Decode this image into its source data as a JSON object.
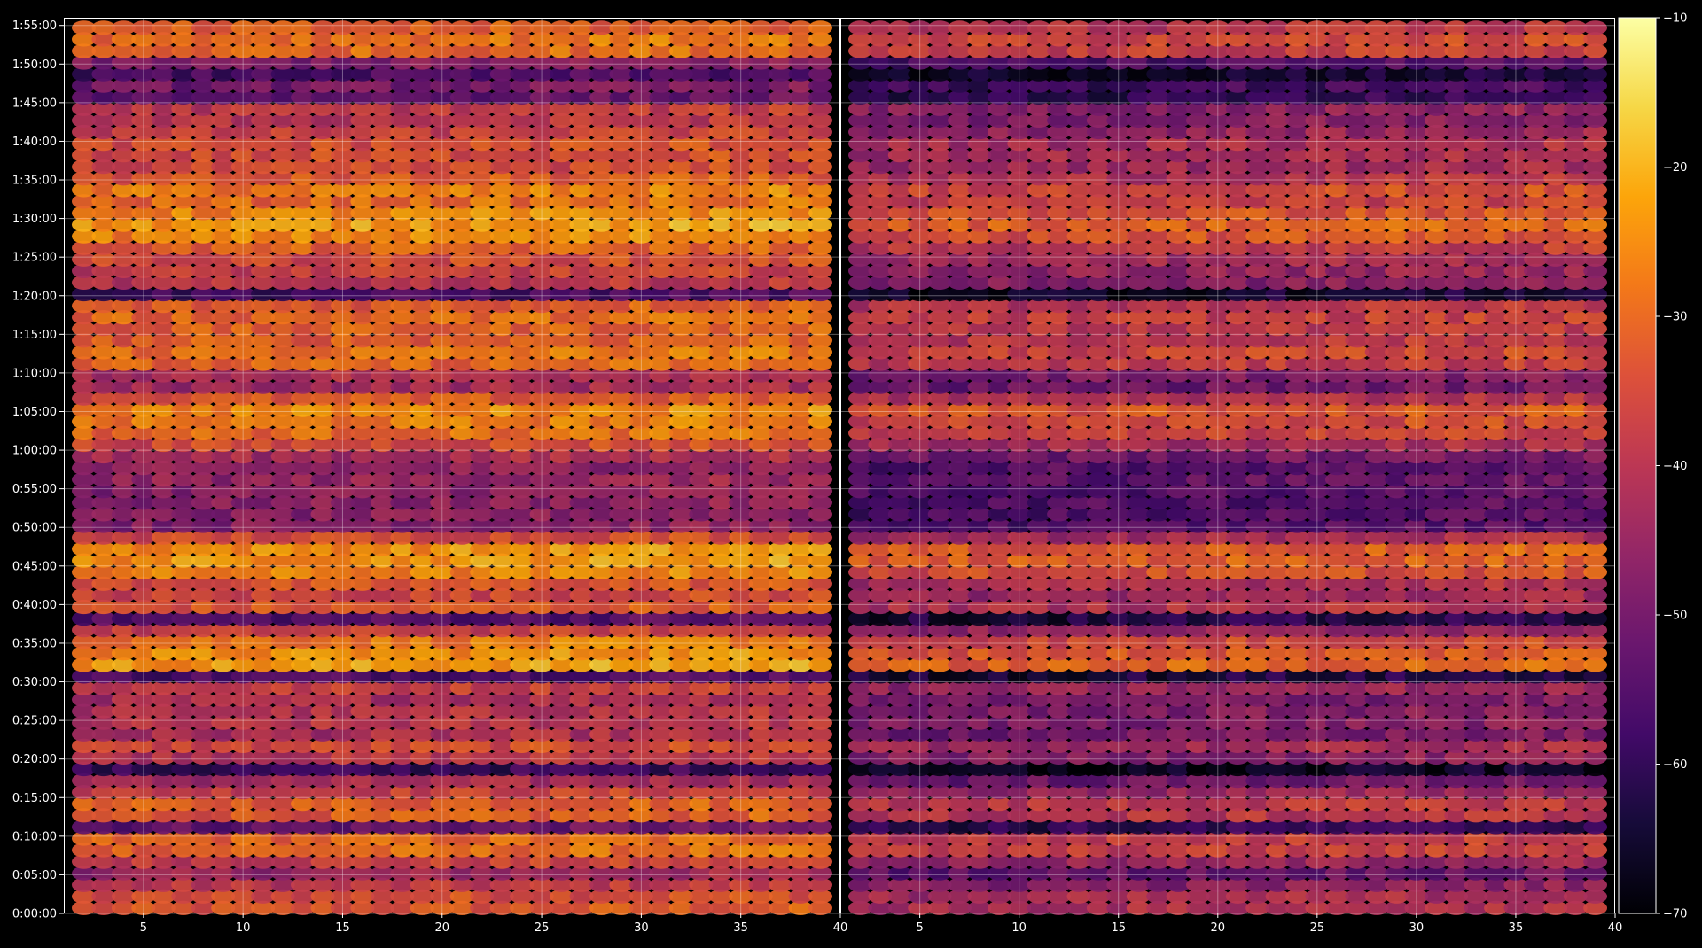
{
  "chart_data": {
    "type": "heatmap",
    "title": "",
    "colormap": "inferno",
    "background": "#000000",
    "y_ticks": [
      "0:00:00",
      "0:05:00",
      "0:10:00",
      "0:15:00",
      "0:20:00",
      "0:25:00",
      "0:30:00",
      "0:35:00",
      "0:40:00",
      "0:45:00",
      "0:50:00",
      "0:55:00",
      "1:00:00",
      "1:05:00",
      "1:10:00",
      "1:15:00",
      "1:20:00",
      "1:25:00",
      "1:30:00",
      "1:35:00",
      "1:40:00",
      "1:45:00",
      "1:50:00",
      "1:55:00"
    ],
    "y_range_minutes": [
      0,
      116
    ],
    "grid": true,
    "panels": [
      {
        "name": "left",
        "xlabel": "",
        "xlim": [
          1,
          40
        ],
        "x_ticks": [
          5,
          10,
          15,
          20,
          25,
          30,
          35,
          40
        ],
        "x_columns": [
          2,
          39
        ],
        "level_offset": 0
      },
      {
        "name": "right",
        "xlabel": "",
        "xlim": [
          1,
          40
        ],
        "x_ticks": [
          5,
          10,
          15,
          20,
          25,
          30,
          35,
          40
        ],
        "x_columns": [
          2,
          39
        ],
        "level_offset": -8
      }
    ],
    "colorbar": {
      "label": "",
      "range": [
        -70,
        -10
      ],
      "ticks": [
        -10,
        -20,
        -30,
        -40,
        -50,
        -60,
        -70
      ],
      "placement": "right"
    },
    "row_profile": {
      "description_units": "minutes, dB",
      "points": [
        [
          0.0,
          -34
        ],
        [
          1.5,
          -32
        ],
        [
          3.5,
          -38
        ],
        [
          5.0,
          -45
        ],
        [
          6.5,
          -38
        ],
        [
          8.0,
          -30
        ],
        [
          9.5,
          -26
        ],
        [
          11.0,
          -55
        ],
        [
          12.5,
          -32
        ],
        [
          14.0,
          -30
        ],
        [
          15.5,
          -36
        ],
        [
          17.0,
          -40
        ],
        [
          18.5,
          -62
        ],
        [
          20.0,
          -40
        ],
        [
          21.5,
          -34
        ],
        [
          23.0,
          -42
        ],
        [
          24.5,
          -40
        ],
        [
          26.0,
          -40
        ],
        [
          27.5,
          -42
        ],
        [
          29.5,
          -36
        ],
        [
          30.5,
          -60
        ],
        [
          32.0,
          -22
        ],
        [
          33.5,
          -24
        ],
        [
          35.0,
          -26
        ],
        [
          36.5,
          -34
        ],
        [
          38.0,
          -58
        ],
        [
          39.5,
          -32
        ],
        [
          40.5,
          -34
        ],
        [
          42.0,
          -38
        ],
        [
          43.5,
          -28
        ],
        [
          45.0,
          -24
        ],
        [
          46.5,
          -22
        ],
        [
          48.0,
          -26
        ],
        [
          49.5,
          -44
        ],
        [
          51.0,
          -50
        ],
        [
          52.5,
          -44
        ],
        [
          54.0,
          -50
        ],
        [
          55.5,
          -42
        ],
        [
          57.0,
          -48
        ],
        [
          58.5,
          -44
        ],
        [
          60.0,
          -40
        ],
        [
          61.5,
          -28
        ],
        [
          63.0,
          -30
        ],
        [
          64.5,
          -24
        ],
        [
          66.0,
          -26
        ],
        [
          67.5,
          -40
        ],
        [
          69.0,
          -46
        ],
        [
          70.5,
          -34
        ],
        [
          72.0,
          -26
        ],
        [
          73.5,
          -30
        ],
        [
          75.0,
          -32
        ],
        [
          76.5,
          -30
        ],
        [
          78.5,
          -28
        ],
        [
          80.5,
          -62
        ],
        [
          82.0,
          -34
        ],
        [
          83.5,
          -38
        ],
        [
          85.0,
          -34
        ],
        [
          86.5,
          -30
        ],
        [
          88.0,
          -24
        ],
        [
          89.5,
          -22
        ],
        [
          91.0,
          -26
        ],
        [
          92.5,
          -30
        ],
        [
          94.0,
          -26
        ],
        [
          95.5,
          -34
        ],
        [
          97.0,
          -36
        ],
        [
          98.5,
          -34
        ],
        [
          100.0,
          -34
        ],
        [
          101.5,
          -38
        ],
        [
          103.0,
          -40
        ],
        [
          104.5,
          -38
        ],
        [
          106.0,
          -56
        ],
        [
          107.5,
          -48
        ],
        [
          109.5,
          -62
        ],
        [
          111.0,
          -32
        ],
        [
          112.5,
          -26
        ],
        [
          114.0,
          -30
        ],
        [
          115.5,
          -34
        ]
      ]
    }
  }
}
